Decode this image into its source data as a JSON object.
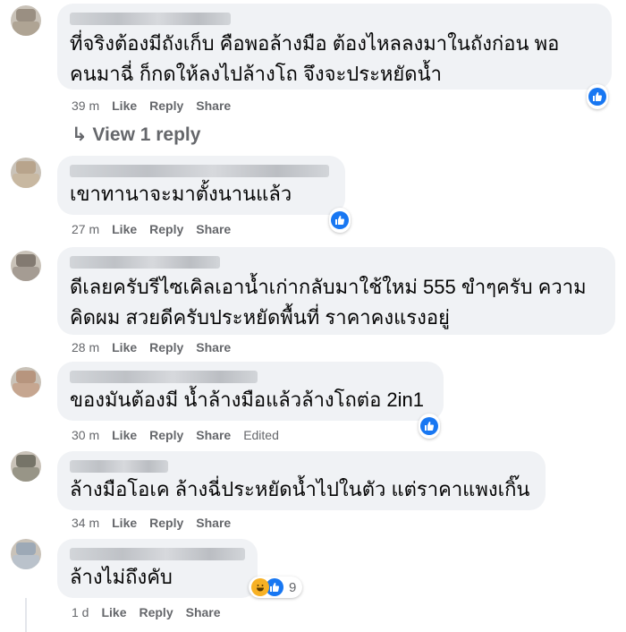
{
  "comments": [
    {
      "text": "ที่จริงต้องมีถังเก็บ คือพอล้างมือ ต้องไหลลงมาในถังก่อน พอคนมาฉี่ ก็กดให้ลงไปล้างโถ จึงจะประหยัดน้ำ",
      "line1": "ที่จริงต้องมีถังเก็บ คือพอล้างมือ ต้องไหลลงมาในถังก่อน พอ",
      "line2": "คนมาฉี่ ก็กดให้ลงไปล้างโถ จึงจะประหยัดน้ำ",
      "time": "39 m",
      "like": "Like",
      "reply": "Reply",
      "share": "Share"
    },
    {
      "line1": "เขาทานาจะมาตั้งนานแล้ว",
      "time": "27 m",
      "like": "Like",
      "reply": "Reply",
      "share": "Share"
    },
    {
      "line1": "ดีเลยครับรีไซเคิลเอาน้ำเก่ากลับมาใช้ใหม่ 555 ขำๆครับ ความ",
      "line2": "คิดผม สวยดีครับประหยัดพื้นที่ ราคาคงแรงอยู่",
      "time": "28 m",
      "like": "Like",
      "reply": "Reply",
      "share": "Share"
    },
    {
      "line1": "ของมันต้องมี น้ำล้างมือแล้วล้างโถต่อ 2in1",
      "time": "30 m",
      "like": "Like",
      "reply": "Reply",
      "share": "Share",
      "edited": "Edited"
    },
    {
      "line1": "ล้างมือโอเค ล้างฉี่ประหยัดน้ำไปในตัว แต่ราคาแพงเกิ๊น",
      "time": "34 m",
      "like": "Like",
      "reply": "Reply",
      "share": "Share"
    },
    {
      "line1": "ล้างไม่ถึงคับ",
      "time": "1 d",
      "like": "Like",
      "reply": "Reply",
      "share": "Share",
      "reaction_count": "9"
    }
  ],
  "view_replies": "↳ View 1 reply",
  "colors": {
    "like_blue": "#1877f2",
    "bubble_bg": "#f0f2f5",
    "meta_gray": "#65676b"
  },
  "icons": [
    "like-icon",
    "haha-icon",
    "reply-arrow-icon"
  ]
}
